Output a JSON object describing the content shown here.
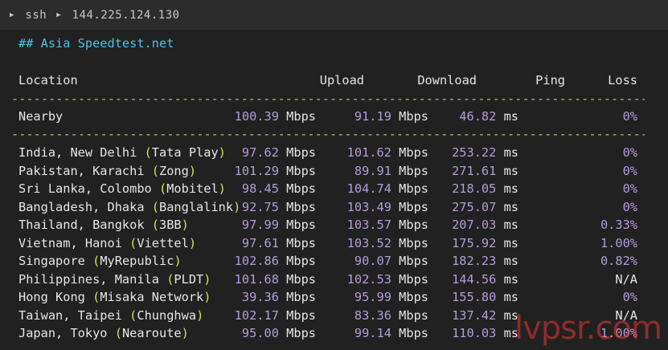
{
  "titlebar": {
    "segments": [
      "ssh",
      "144.225.124.130"
    ]
  },
  "heading": "## Asia Speedtest.net",
  "columns": {
    "location": "Location",
    "upload": "Upload",
    "download": "Download",
    "ping": "Ping",
    "loss": "Loss"
  },
  "separator": "----------------------------------------------------------------------------------------------------",
  "nearby": {
    "location": "Nearby",
    "upload": "100.39",
    "upload_unit": "Mbps",
    "download": "91.19",
    "download_unit": "Mbps",
    "ping": "46.82",
    "ping_unit": "ms",
    "loss": "0%"
  },
  "rows": [
    {
      "place": "India, New Delhi ",
      "open": "(",
      "isp": "Tata Play",
      "close": ")",
      "upload": "97.62",
      "upload_unit": "Mbps",
      "download": "101.62",
      "download_unit": "Mbps",
      "ping": "253.22",
      "ping_unit": "ms",
      "loss": "0%"
    },
    {
      "place": "Pakistan, Karachi ",
      "open": "(",
      "isp": "Zong",
      "close": ")",
      "upload": "101.29",
      "upload_unit": "Mbps",
      "download": "89.91",
      "download_unit": "Mbps",
      "ping": "271.61",
      "ping_unit": "ms",
      "loss": "0%"
    },
    {
      "place": "Sri Lanka, Colombo ",
      "open": "(",
      "isp": "Mobitel",
      "close": ")",
      "upload": "98.45",
      "upload_unit": "Mbps",
      "download": "104.74",
      "download_unit": "Mbps",
      "ping": "218.05",
      "ping_unit": "ms",
      "loss": "0%"
    },
    {
      "place": "Bangladesh, Dhaka ",
      "open": "(",
      "isp": "Banglalink",
      "close": ")",
      "upload": "92.75",
      "upload_unit": "Mbps",
      "download": "103.49",
      "download_unit": "Mbps",
      "ping": "275.07",
      "ping_unit": "ms",
      "loss": "0%"
    },
    {
      "place": "Thailand, Bangkok ",
      "open": "(",
      "isp": "3BB",
      "close": ")",
      "upload": "97.99",
      "upload_unit": "Mbps",
      "download": "103.57",
      "download_unit": "Mbps",
      "ping": "207.03",
      "ping_unit": "ms",
      "loss": "0.33%"
    },
    {
      "place": "Vietnam, Hanoi ",
      "open": "(",
      "isp": "Viettel",
      "close": ")",
      "upload": "97.61",
      "upload_unit": "Mbps",
      "download": "103.52",
      "download_unit": "Mbps",
      "ping": "175.92",
      "ping_unit": "ms",
      "loss": "1.00%"
    },
    {
      "place": "Singapore ",
      "open": "(",
      "isp": "MyRepublic",
      "close": ")",
      "upload": "102.86",
      "upload_unit": "Mbps",
      "download": "90.07",
      "download_unit": "Mbps",
      "ping": "182.23",
      "ping_unit": "ms",
      "loss": "0.82%"
    },
    {
      "place": "Philippines, Manila ",
      "open": "(",
      "isp": "PLDT",
      "close": ")",
      "upload": "101.68",
      "upload_unit": "Mbps",
      "download": "102.53",
      "download_unit": "Mbps",
      "ping": "144.56",
      "ping_unit": "ms",
      "loss": "N/A"
    },
    {
      "place": "Hong Kong ",
      "open": "(",
      "isp": "Misaka Network",
      "close": ")",
      "upload": "39.36",
      "upload_unit": "Mbps",
      "download": "95.99",
      "download_unit": "Mbps",
      "ping": "155.80",
      "ping_unit": "ms",
      "loss": "0%"
    },
    {
      "place": "Taiwan, Taipei ",
      "open": "(",
      "isp": "Chunghwa",
      "close": ")",
      "upload": "102.17",
      "upload_unit": "Mbps",
      "download": "83.36",
      "download_unit": "Mbps",
      "ping": "137.42",
      "ping_unit": "ms",
      "loss": "N/A"
    },
    {
      "place": "Japan, Tokyo ",
      "open": "(",
      "isp": "Nearoute",
      "close": ")",
      "upload": "95.00",
      "upload_unit": "Mbps",
      "download": "99.14",
      "download_unit": "Mbps",
      "ping": "110.03",
      "ping_unit": "ms",
      "loss": "1.00%"
    }
  ],
  "watermark": "lvpsr.com",
  "colors": {
    "background": "#212121",
    "titlebar": "#2c2c2c",
    "heading": "#4fc1e8",
    "number": "#b39ddb",
    "paren": "#d4e157",
    "separator": "#9ccc65",
    "watermark": "#e53935"
  }
}
